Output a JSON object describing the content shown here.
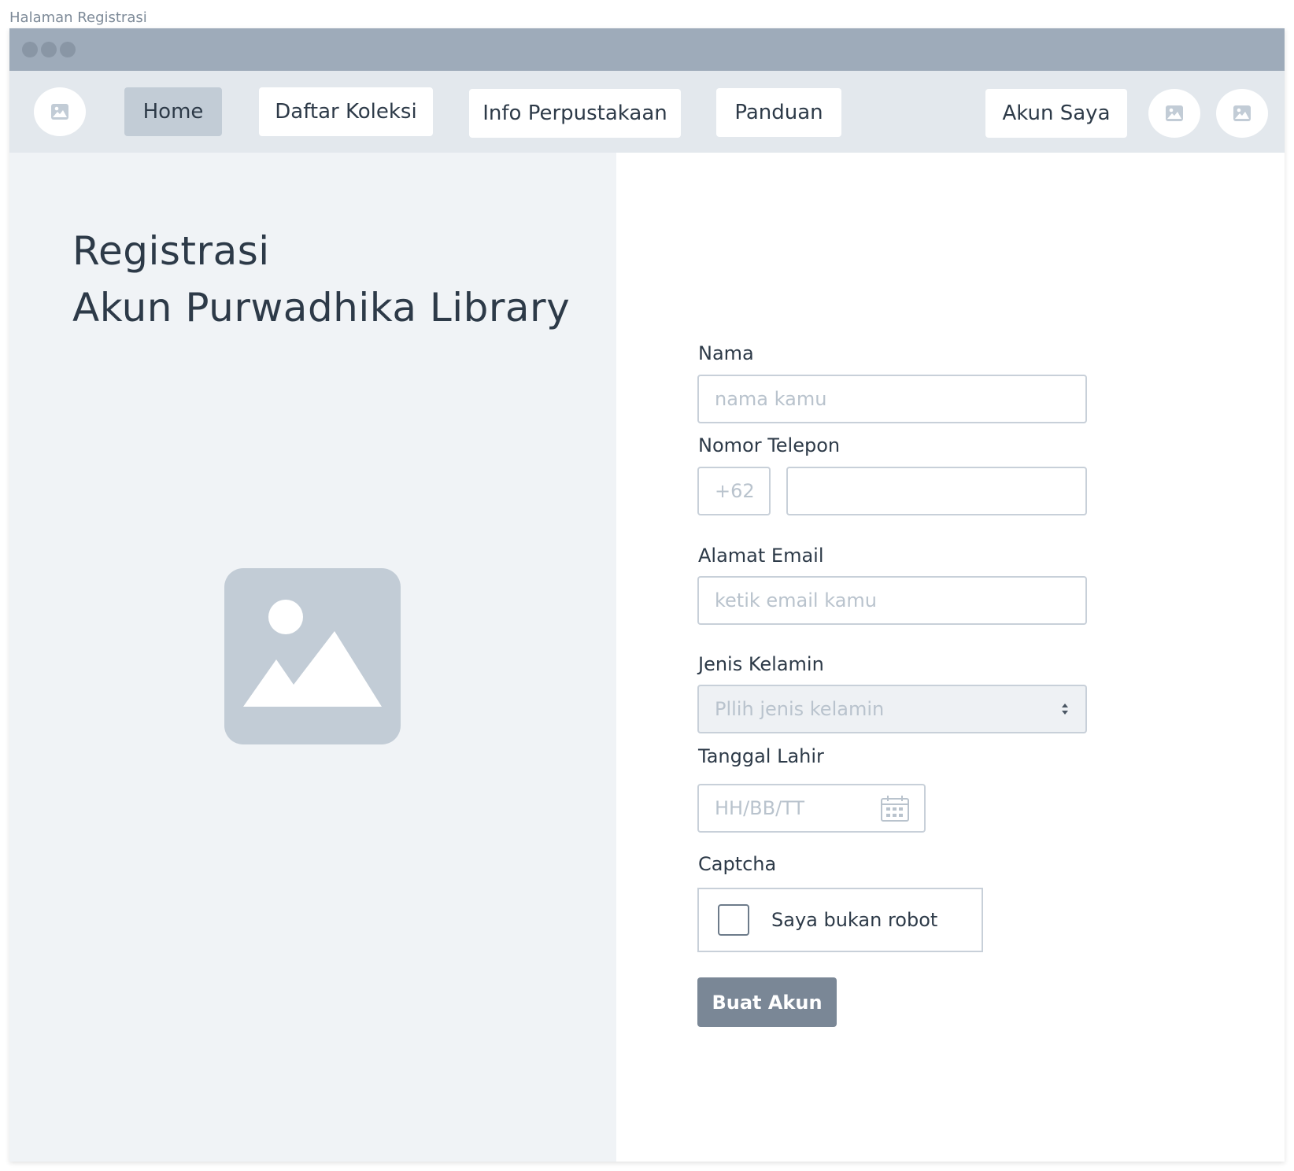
{
  "page_label": "Halaman Registrasi",
  "nav": {
    "items": [
      {
        "label": "Home",
        "active": true
      },
      {
        "label": "Daftar Koleksi",
        "active": false
      },
      {
        "label": "Info Perpustakaan",
        "active": false
      },
      {
        "label": "Panduan",
        "active": false
      }
    ],
    "account_label": "Akun Saya"
  },
  "hero": {
    "title_line1": "Registrasi",
    "title_line2": "Akun Purwadhika Library"
  },
  "form": {
    "name": {
      "label": "Nama",
      "placeholder": "nama kamu",
      "value": ""
    },
    "phone": {
      "label": "Nomor Telepon",
      "prefix_placeholder": "+62",
      "value": ""
    },
    "email": {
      "label": "Alamat Email",
      "placeholder": "ketik email kamu",
      "value": ""
    },
    "gender": {
      "label": "Jenis Kelamin",
      "placeholder": "Pllih jenis kelamin"
    },
    "birthdate": {
      "label": "Tanggal Lahir",
      "placeholder": "HH/BB/TT"
    },
    "captcha": {
      "label": "Captcha",
      "checkbox_label": "Saya bukan robot",
      "checked": false
    },
    "submit_label": "Buat Akun"
  },
  "icons": {
    "image_placeholder": "image-icon",
    "calendar": "calendar-icon",
    "select_arrows": "sort-arrows-icon"
  },
  "colors": {
    "titlebar": "#9eabba",
    "navbar": "#e3e8ed",
    "active_nav": "#c2ccd6",
    "left_panel": "#f0f3f6",
    "submit_button": "#7a8796",
    "placeholder_image": "#c2ccd6"
  }
}
